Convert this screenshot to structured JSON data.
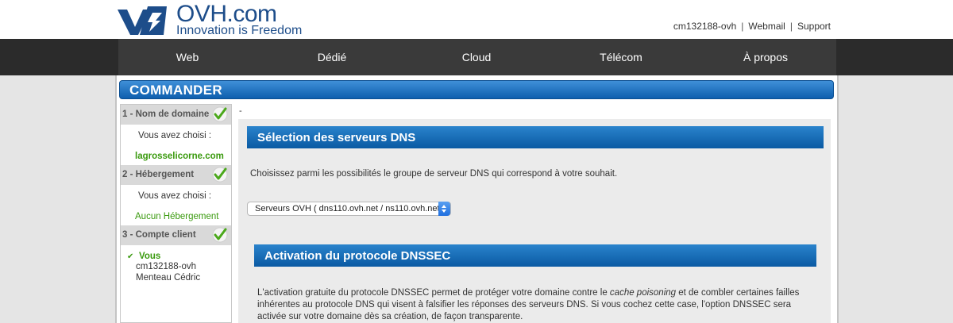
{
  "header": {
    "logo_name": "OVH.com",
    "logo_tagline": "Innovation is Freedom",
    "links": [
      "cm132188-ovh",
      "Webmail",
      "Support"
    ]
  },
  "nav": [
    "Web",
    "Dédié",
    "Cloud",
    "Télécom",
    "À propos"
  ],
  "commander_title": "COMMANDER",
  "sidebar": {
    "steps": [
      {
        "label": "1 - Nom de domaine",
        "chosen_label": "Vous avez choisi :",
        "chosen_value": "lagrosselicorne.com"
      },
      {
        "label": "2 - Hébergement",
        "chosen_label": "Vous avez choisi :",
        "chosen_value": "Aucun Hébergement"
      },
      {
        "label": "3 - Compte client",
        "check_mark": "✔",
        "you_label": "Vous",
        "client_id": "cm132188-ovh",
        "client_name": "Menteau  Cédric"
      }
    ]
  },
  "content": {
    "dash": "-",
    "dns_title": "Sélection des serveurs DNS",
    "dns_description": "Choisissez parmi les possibilités le groupe de serveur DNS qui correspond à votre souhait.",
    "dns_selected": "Serveurs OVH ( dns110.ovh.net / ns110.ovh.net",
    "dnssec_title": "Activation du protocole DNSSEC",
    "dnssec_text_1": "L'activation gratuite du protocole DNSSEC permet de protéger votre domaine contre le ",
    "dnssec_text_em": "cache poisoning",
    "dnssec_text_2": " et de combler certaines failles inhérentes au protocole DNS qui visent à falsifier les réponses des serveurs DNS. Si vous cochez cette case, l'option DNSSEC sera activée sur votre domaine dès sa création, de façon transparente."
  },
  "colors": {
    "brand": "#1d4d8a",
    "accent": "#0e5fae",
    "success": "#3a9a0e"
  }
}
